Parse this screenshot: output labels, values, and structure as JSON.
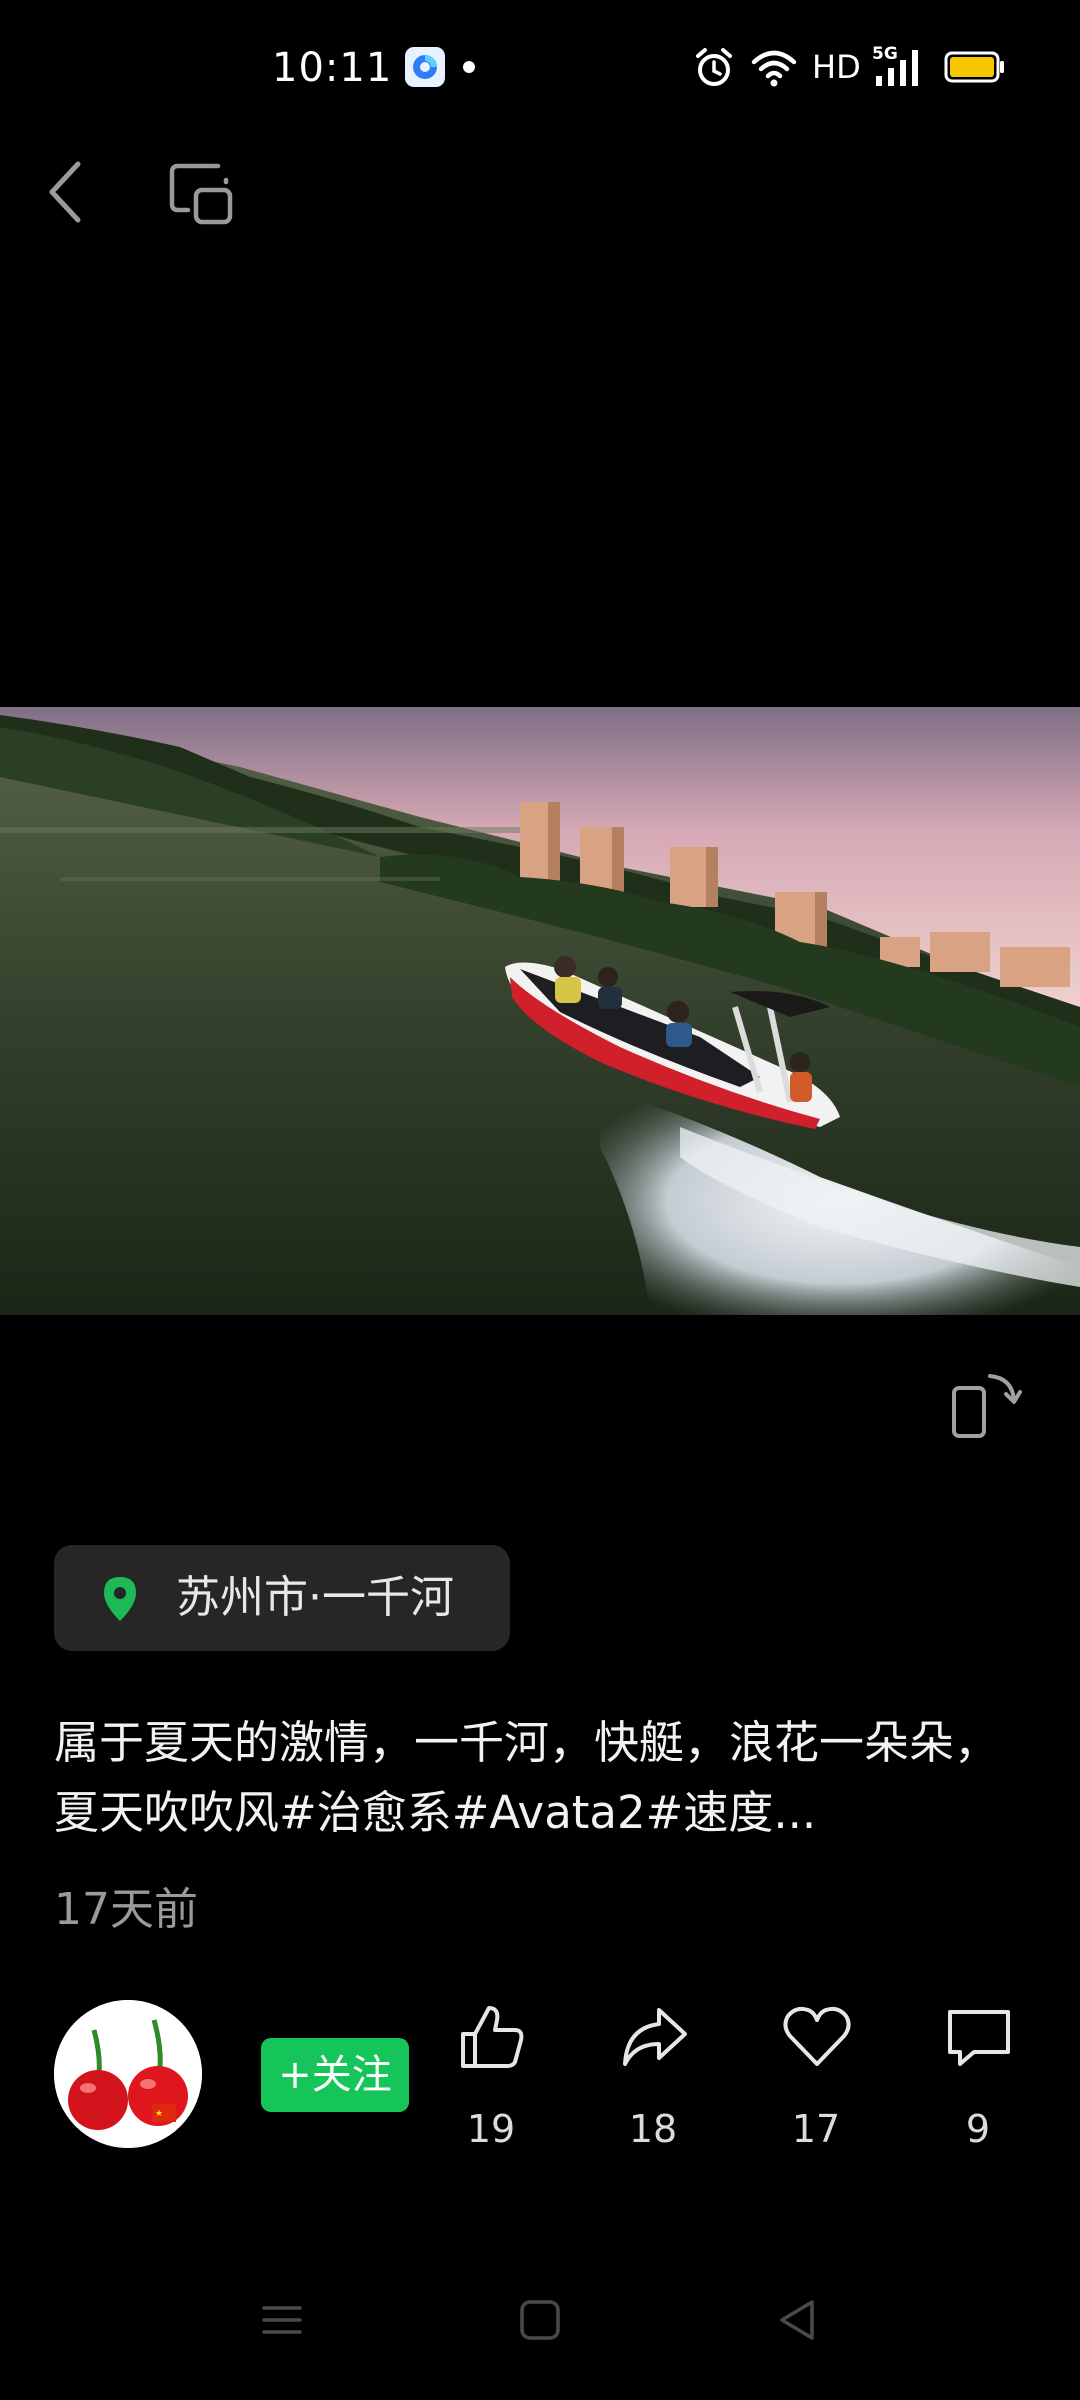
{
  "status_bar": {
    "time": "10:11",
    "hd_label": "HD",
    "network_label": "5G",
    "icons": [
      "browser-app-icon",
      "notification-dot",
      "alarm-icon",
      "wifi-icon",
      "signal-icon",
      "battery-icon"
    ]
  },
  "nav": {
    "icons": [
      "back-arrow-icon",
      "picture-in-picture-icon"
    ]
  },
  "video": {
    "icons": [
      "rotate-screen-icon"
    ]
  },
  "location": {
    "text": "苏州市·一千河",
    "pin_color": "#1db954"
  },
  "post": {
    "caption": "属于夏天的激情，一千河，快艇，浪花一朵朵，夏天吹吹风#治愈系#Avata2#速度...",
    "time_ago": "17天前"
  },
  "author": {
    "follow_label": "+关注",
    "name_fragment": "\n",
    "accent": "#15c55a"
  },
  "actions": {
    "like_count": "19",
    "share_count": "18",
    "favorite_count": "17",
    "comment_count": "9"
  },
  "system_nav": {
    "icons": [
      "menu-icon",
      "home-icon",
      "back-triangle-icon"
    ]
  }
}
